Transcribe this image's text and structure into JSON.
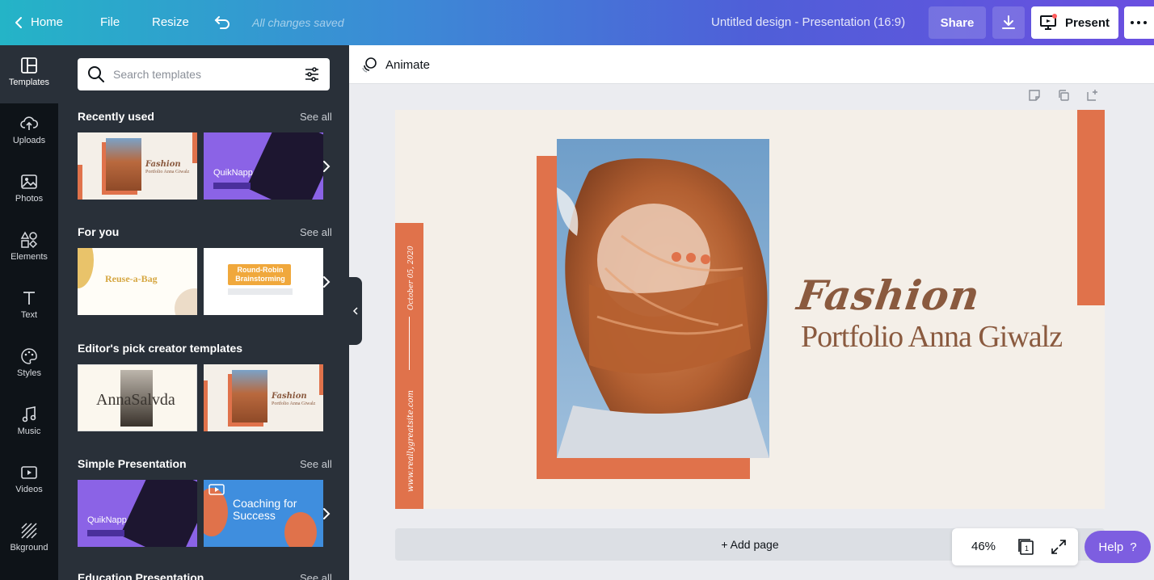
{
  "topbar": {
    "home": "Home",
    "file": "File",
    "resize": "Resize",
    "saved_status": "All changes saved",
    "design_title": "Untitled design - Presentation (16:9)",
    "share": "Share",
    "present": "Present"
  },
  "rail": {
    "items": [
      {
        "label": "Templates",
        "icon": "templates-icon"
      },
      {
        "label": "Uploads",
        "icon": "upload-icon"
      },
      {
        "label": "Photos",
        "icon": "photo-icon"
      },
      {
        "label": "Elements",
        "icon": "elements-icon"
      },
      {
        "label": "Text",
        "icon": "text-icon"
      },
      {
        "label": "Styles",
        "icon": "palette-icon"
      },
      {
        "label": "Music",
        "icon": "music-icon"
      },
      {
        "label": "Videos",
        "icon": "video-icon"
      },
      {
        "label": "Bkground",
        "icon": "background-icon"
      }
    ]
  },
  "panel": {
    "search_placeholder": "Search templates",
    "see_all": "See all",
    "sections": [
      {
        "title": "Recently used"
      },
      {
        "title": "For you"
      },
      {
        "title": "Editor's pick creator templates"
      },
      {
        "title": "Simple Presentation"
      },
      {
        "title": "Education Presentation"
      }
    ],
    "thumbs": {
      "fashion_title": "Fashion",
      "fashion_sub": "Portfolio Anna Giwalz",
      "quiknapp": "QuikNapp",
      "reuse": "Reuse-a-Bag",
      "roundrobin": "Round-Robin Brainstorming",
      "anna": "AnnaSalvda",
      "coaching": "Coaching for Success"
    }
  },
  "editor": {
    "animate": "Animate",
    "add_page": "+ Add page",
    "zoom": "46%",
    "page_count": "1",
    "help": "Help",
    "help_symbol": "?"
  },
  "slide": {
    "title": "Fashion",
    "subtitle": "Portfolio Anna Giwalz",
    "date": "October 05, 2020",
    "url": "www.reallygreatsite.com"
  },
  "colors": {
    "accent_orange": "#e0724b",
    "slide_bg": "#f4efe8",
    "title_brown": "#8a5a3f",
    "help_purple": "#7d5ee0",
    "panel_dark": "#293039"
  }
}
